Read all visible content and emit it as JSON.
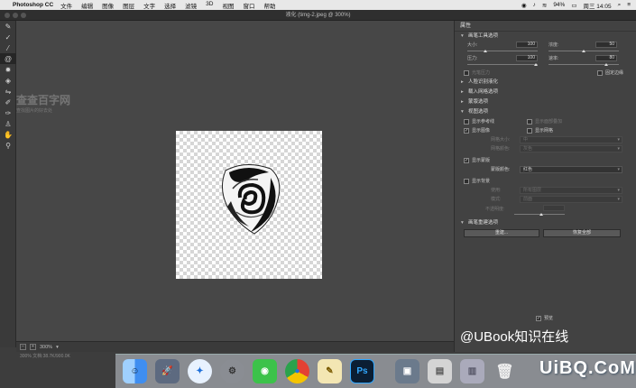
{
  "menubar": {
    "app_name": "Photoshop CC",
    "menus": [
      "文件",
      "编辑",
      "图像",
      "图层",
      "文字",
      "选择",
      "滤镜",
      "3D",
      "视图",
      "窗口",
      "帮助"
    ],
    "battery": "94%",
    "clock": "周三 14:05"
  },
  "window": {
    "title": "液化 (timg-2.jpeg @ 300%)"
  },
  "tools": [
    "forward-warp-icon",
    "reconstruct-icon",
    "smooth-icon",
    "twirl-icon",
    "pucker-icon",
    "bloat-icon",
    "push-left-icon",
    "freeze-mask-icon",
    "thaw-mask-icon",
    "face-tool-icon",
    "hand-icon",
    "zoom-icon"
  ],
  "canvas_watermark": {
    "title": "查查百字网",
    "sub": "查找图片的好去处"
  },
  "status": {
    "zoom": "300%",
    "doc_info": "300%   文档:38.7K/900.0K"
  },
  "panel": {
    "title": "属性",
    "brush": {
      "header": "画笔工具选项",
      "size_label": "大小:",
      "size_value": "100",
      "density_label": "浓度:",
      "density_value": "50",
      "pressure_label": "压力:",
      "pressure_value": "100",
      "rate_label": "速率:",
      "rate_value": "80",
      "stylus_label": "光笔压力",
      "pin_edges_label": "固定边缘"
    },
    "sections": {
      "face": "人脸识别液化",
      "load_mesh": "载入网格选项",
      "mask": "蒙版选项",
      "view": "视图选项"
    },
    "view_options": {
      "show_guides": "显示参考线",
      "show_face_overlay": "显示面部叠加",
      "show_image": "显示图像",
      "show_mesh": "显示网格",
      "mesh_size_label": "网格大小:",
      "mesh_size_value": "中",
      "mesh_color_label": "网格颜色:",
      "mesh_color_value": "灰色",
      "show_mask": "显示蒙版",
      "mask_color_label": "蒙版颜色:",
      "mask_color_value": "红色",
      "show_backdrop": "显示背景",
      "use_label": "使用:",
      "use_value": "所有图层",
      "mode_label": "模式:",
      "mode_value": "前面",
      "opacity_label": "不透明度:"
    },
    "rebuild": {
      "header": "画笔重建选项",
      "rebuild_button": "重建...",
      "restore_all_button": "恢复全部"
    },
    "preview_label": "预览"
  },
  "overlay_watermark": "@UBook知识在线",
  "site_watermark": "UiBQ.CoM",
  "colors": {
    "menubar_bg": "#e8e8e8",
    "workspace_bg": "#474747",
    "panel_bg": "#424242"
  }
}
